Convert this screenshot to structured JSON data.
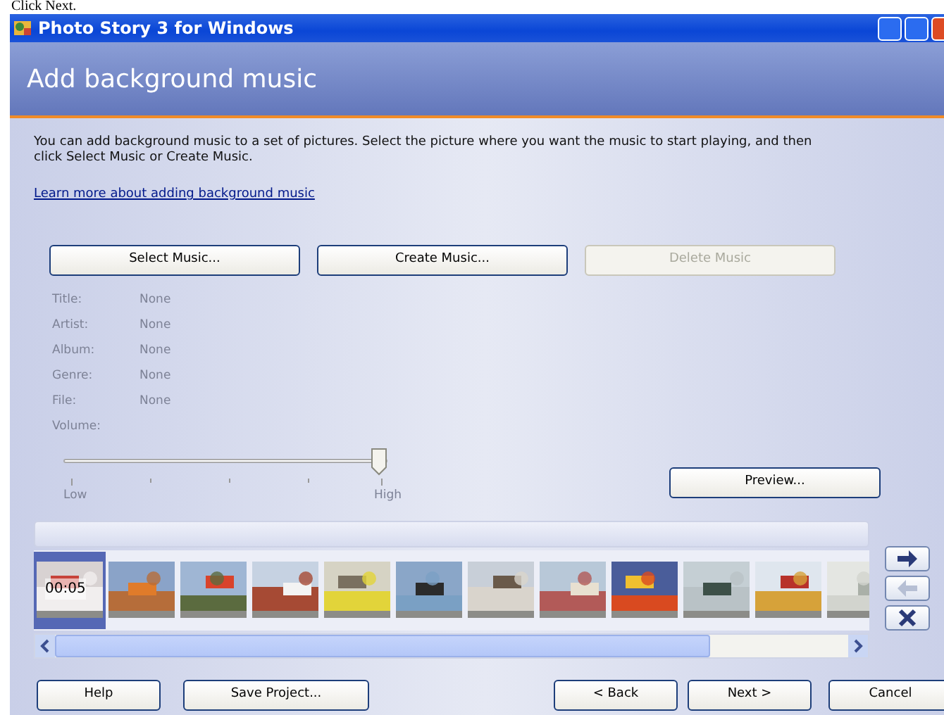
{
  "caption": "Click Next.",
  "window": {
    "title": "Photo Story 3 for Windows"
  },
  "header": {
    "title": "Add background music"
  },
  "intro": "You can add background music to a set of pictures.  Select the picture where you want the music to start playing, and then click Select Music or Create Music.",
  "learn_more_link": "Learn more about adding background music",
  "music_buttons": [
    {
      "label": "Select Music...",
      "disabled": false
    },
    {
      "label": "Create Music...",
      "disabled": false
    },
    {
      "label": "Delete Music",
      "disabled": true
    }
  ],
  "music_info": {
    "disabled": true,
    "rows": [
      {
        "label": "Title:",
        "value": "None"
      },
      {
        "label": "Artist:",
        "value": "None"
      },
      {
        "label": "Album:",
        "value": "None"
      },
      {
        "label": "Genre:",
        "value": "None"
      },
      {
        "label": "File:",
        "value": "None"
      }
    ]
  },
  "volume": {
    "label": "Volume:",
    "level": 1.0,
    "min_label": "Low",
    "max_label": "High"
  },
  "preview_button": "Preview...",
  "filmstrip": [
    {
      "selected": true,
      "time": "00:05"
    },
    {
      "selected": false
    },
    {
      "selected": false
    },
    {
      "selected": false
    },
    {
      "selected": false
    },
    {
      "selected": false
    },
    {
      "selected": false
    },
    {
      "selected": false
    },
    {
      "selected": false
    },
    {
      "selected": false
    },
    {
      "selected": false
    },
    {
      "selected": false
    }
  ],
  "side_buttons": [
    {
      "kind": "move-right",
      "disabled": false
    },
    {
      "kind": "move-left",
      "disabled": true
    },
    {
      "kind": "remove",
      "disabled": false
    }
  ],
  "footer_buttons": [
    {
      "label": "Help"
    },
    {
      "label": "Save Project..."
    },
    {
      "label": "< Back"
    },
    {
      "label": "Next >"
    },
    {
      "label": "Cancel"
    }
  ]
}
